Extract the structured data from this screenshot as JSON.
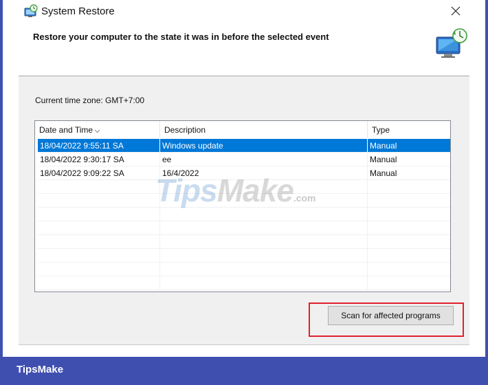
{
  "window": {
    "title": "System Restore",
    "close_icon": "close-icon",
    "app_icon": "system-restore-icon"
  },
  "header": {
    "heading": "Restore your computer to the state it was in before the selected event",
    "icon": "system-restore-large-icon"
  },
  "timezone": "Current time zone: GMT+7:00",
  "table": {
    "columns": [
      "Date and Time",
      "Description",
      "Type"
    ],
    "sort_icon": "sort-chevron-down-icon",
    "rows": [
      {
        "date": "18/04/2022 9:55:11 SA",
        "description": "Windows update",
        "type": "Manual",
        "selected": true
      },
      {
        "date": "18/04/2022 9:30:17 SA",
        "description": "ee",
        "type": "Manual",
        "selected": false
      },
      {
        "date": "18/04/2022 9:09:22 SA",
        "description": "16/4/2022",
        "type": "Manual",
        "selected": false
      }
    ]
  },
  "scan_button": "Scan for affected programs",
  "watermark": {
    "tips": "Tips",
    "make": "Make",
    "com": ".com"
  },
  "brand": "TipsMake",
  "colors": {
    "selection": "#0078d7",
    "highlight": "#e0202a",
    "frame": "#3f4fb0"
  }
}
